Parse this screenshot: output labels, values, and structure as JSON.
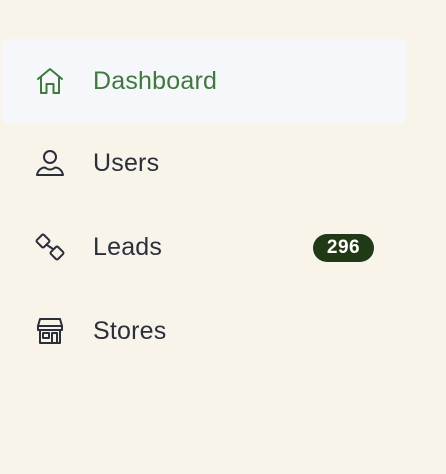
{
  "sidebar": {
    "items": [
      {
        "label": "Dashboard",
        "icon": "home-icon",
        "active": true
      },
      {
        "label": "Users",
        "icon": "user-icon",
        "active": false
      },
      {
        "label": "Leads",
        "icon": "link-icon",
        "active": false,
        "badge": "296"
      },
      {
        "label": "Stores",
        "icon": "store-icon",
        "active": false
      }
    ]
  },
  "colors": {
    "background": "#f8f4ea",
    "active_background": "#f5f7fa",
    "active_text": "#3f7a3d",
    "text": "#2b2f3a",
    "badge_background": "#1f3a14",
    "badge_text": "#ffffff"
  }
}
